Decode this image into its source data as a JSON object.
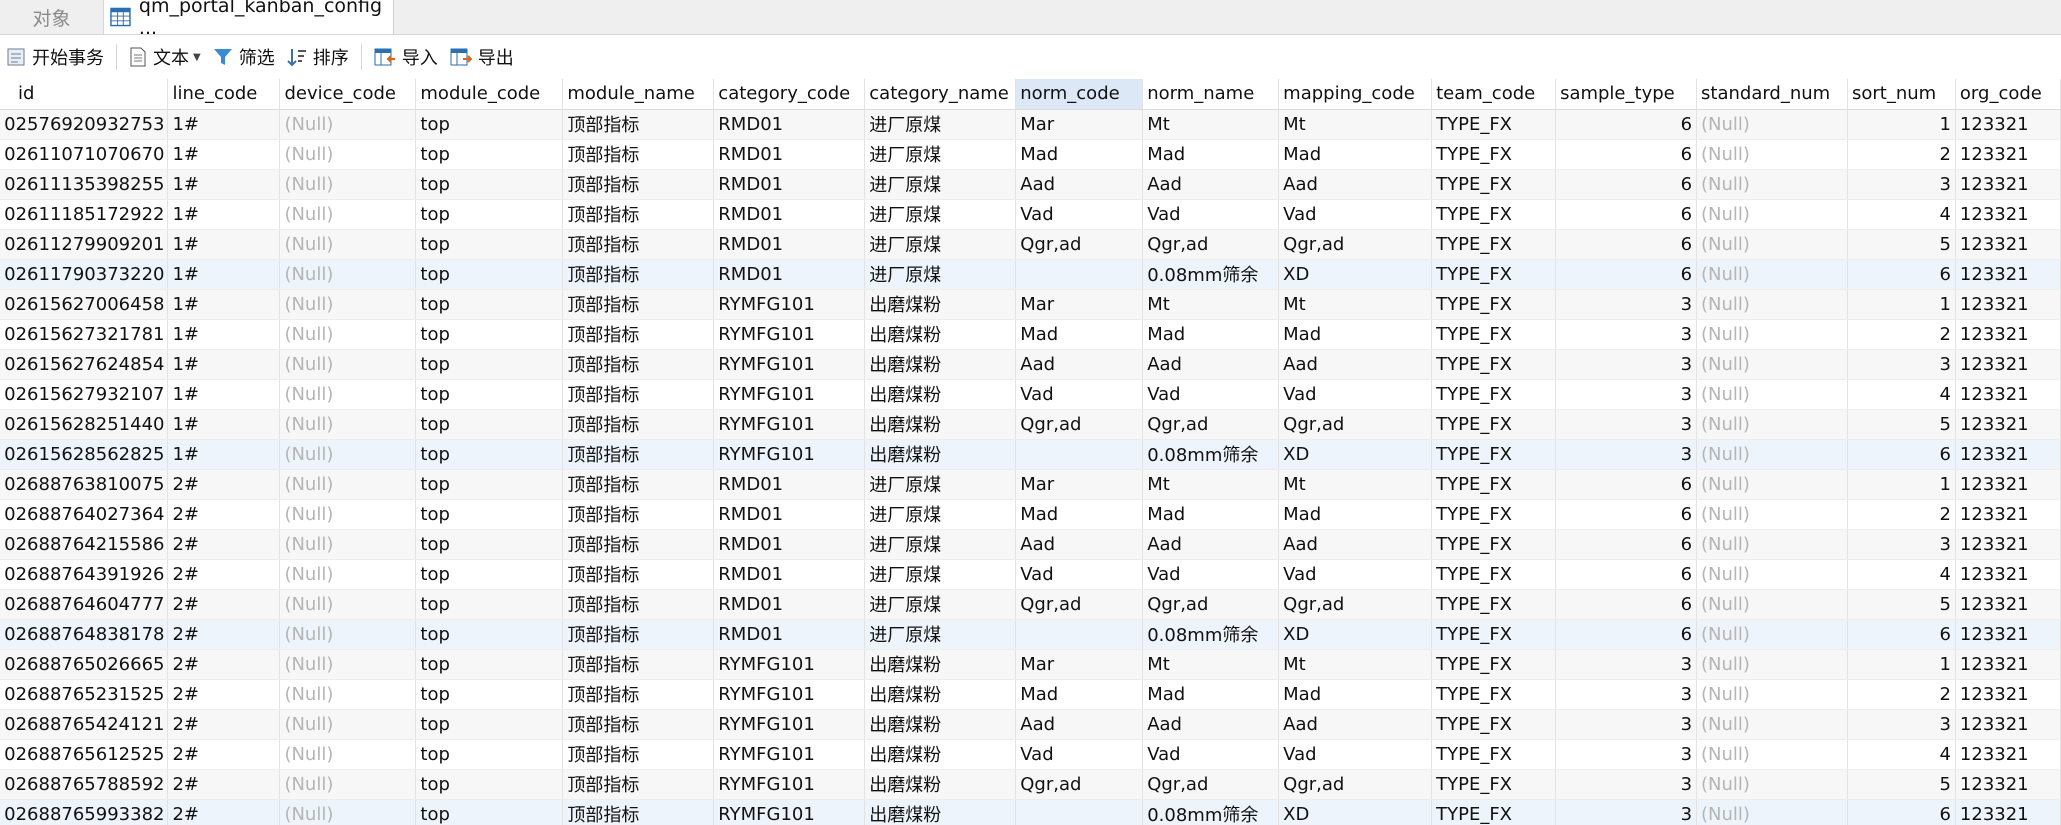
{
  "tabs": {
    "objects_label": "对象",
    "table_tab_label": "qm_portal_kanban_config ..."
  },
  "toolbar": {
    "begin_txn": "开始事务",
    "text": "文本",
    "filter": "筛选",
    "sort": "排序",
    "import": "导入",
    "export": "导出"
  },
  "colors": {
    "selected_header": "#dde8f6",
    "null_text": "#b5b5b5",
    "current_row": "#eef4fb"
  },
  "table": {
    "columns": [
      "id",
      "line_code",
      "device_code",
      "module_code",
      "module_name",
      "category_code",
      "category_name",
      "norm_code",
      "norm_name",
      "mapping_code",
      "team_code",
      "sample_type",
      "standard_num",
      "sort_num",
      "org_code"
    ],
    "selected_column": "norm_code",
    "rows": [
      [
        "02576920932753",
        "1#",
        "(Null)",
        "top",
        "顶部指标",
        "RMD01",
        "进厂原煤",
        "Mar",
        "Mt",
        "Mt",
        "TYPE_FX",
        "6",
        "(Null)",
        "1",
        "123321"
      ],
      [
        "02611071070670",
        "1#",
        "(Null)",
        "top",
        "顶部指标",
        "RMD01",
        "进厂原煤",
        "Mad",
        "Mad",
        "Mad",
        "TYPE_FX",
        "6",
        "(Null)",
        "2",
        "123321"
      ],
      [
        "02611135398255",
        "1#",
        "(Null)",
        "top",
        "顶部指标",
        "RMD01",
        "进厂原煤",
        "Aad",
        "Aad",
        "Aad",
        "TYPE_FX",
        "6",
        "(Null)",
        "3",
        "123321"
      ],
      [
        "02611185172922",
        "1#",
        "(Null)",
        "top",
        "顶部指标",
        "RMD01",
        "进厂原煤",
        "Vad",
        "Vad",
        "Vad",
        "TYPE_FX",
        "6",
        "(Null)",
        "4",
        "123321"
      ],
      [
        "02611279909201",
        "1#",
        "(Null)",
        "top",
        "顶部指标",
        "RMD01",
        "进厂原煤",
        "Qgr,ad",
        "Qgr,ad",
        "Qgr,ad",
        "TYPE_FX",
        "6",
        "(Null)",
        "5",
        "123321"
      ],
      [
        "02611790373220",
        "1#",
        "(Null)",
        "top",
        "顶部指标",
        "RMD01",
        "进厂原煤",
        "",
        "0.08mm筛余",
        "XD",
        "TYPE_FX",
        "6",
        "(Null)",
        "6",
        "123321"
      ],
      [
        "02615627006458",
        "1#",
        "(Null)",
        "top",
        "顶部指标",
        "RYMFG101",
        "出磨煤粉",
        "Mar",
        "Mt",
        "Mt",
        "TYPE_FX",
        "3",
        "(Null)",
        "1",
        "123321"
      ],
      [
        "02615627321781",
        "1#",
        "(Null)",
        "top",
        "顶部指标",
        "RYMFG101",
        "出磨煤粉",
        "Mad",
        "Mad",
        "Mad",
        "TYPE_FX",
        "3",
        "(Null)",
        "2",
        "123321"
      ],
      [
        "02615627624854",
        "1#",
        "(Null)",
        "top",
        "顶部指标",
        "RYMFG101",
        "出磨煤粉",
        "Aad",
        "Aad",
        "Aad",
        "TYPE_FX",
        "3",
        "(Null)",
        "3",
        "123321"
      ],
      [
        "02615627932107",
        "1#",
        "(Null)",
        "top",
        "顶部指标",
        "RYMFG101",
        "出磨煤粉",
        "Vad",
        "Vad",
        "Vad",
        "TYPE_FX",
        "3",
        "(Null)",
        "4",
        "123321"
      ],
      [
        "02615628251440",
        "1#",
        "(Null)",
        "top",
        "顶部指标",
        "RYMFG101",
        "出磨煤粉",
        "Qgr,ad",
        "Qgr,ad",
        "Qgr,ad",
        "TYPE_FX",
        "3",
        "(Null)",
        "5",
        "123321"
      ],
      [
        "02615628562825",
        "1#",
        "(Null)",
        "top",
        "顶部指标",
        "RYMFG101",
        "出磨煤粉",
        "",
        "0.08mm筛余",
        "XD",
        "TYPE_FX",
        "3",
        "(Null)",
        "6",
        "123321"
      ],
      [
        "02688763810075",
        "2#",
        "(Null)",
        "top",
        "顶部指标",
        "RMD01",
        "进厂原煤",
        "Mar",
        "Mt",
        "Mt",
        "TYPE_FX",
        "6",
        "(Null)",
        "1",
        "123321"
      ],
      [
        "02688764027364",
        "2#",
        "(Null)",
        "top",
        "顶部指标",
        "RMD01",
        "进厂原煤",
        "Mad",
        "Mad",
        "Mad",
        "TYPE_FX",
        "6",
        "(Null)",
        "2",
        "123321"
      ],
      [
        "02688764215586",
        "2#",
        "(Null)",
        "top",
        "顶部指标",
        "RMD01",
        "进厂原煤",
        "Aad",
        "Aad",
        "Aad",
        "TYPE_FX",
        "6",
        "(Null)",
        "3",
        "123321"
      ],
      [
        "02688764391926",
        "2#",
        "(Null)",
        "top",
        "顶部指标",
        "RMD01",
        "进厂原煤",
        "Vad",
        "Vad",
        "Vad",
        "TYPE_FX",
        "6",
        "(Null)",
        "4",
        "123321"
      ],
      [
        "02688764604777",
        "2#",
        "(Null)",
        "top",
        "顶部指标",
        "RMD01",
        "进厂原煤",
        "Qgr,ad",
        "Qgr,ad",
        "Qgr,ad",
        "TYPE_FX",
        "6",
        "(Null)",
        "5",
        "123321"
      ],
      [
        "02688764838178",
        "2#",
        "(Null)",
        "top",
        "顶部指标",
        "RMD01",
        "进厂原煤",
        "",
        "0.08mm筛余",
        "XD",
        "TYPE_FX",
        "6",
        "(Null)",
        "6",
        "123321"
      ],
      [
        "02688765026665",
        "2#",
        "(Null)",
        "top",
        "顶部指标",
        "RYMFG101",
        "出磨煤粉",
        "Mar",
        "Mt",
        "Mt",
        "TYPE_FX",
        "3",
        "(Null)",
        "1",
        "123321"
      ],
      [
        "02688765231525",
        "2#",
        "(Null)",
        "top",
        "顶部指标",
        "RYMFG101",
        "出磨煤粉",
        "Mad",
        "Mad",
        "Mad",
        "TYPE_FX",
        "3",
        "(Null)",
        "2",
        "123321"
      ],
      [
        "02688765424121",
        "2#",
        "(Null)",
        "top",
        "顶部指标",
        "RYMFG101",
        "出磨煤粉",
        "Aad",
        "Aad",
        "Aad",
        "TYPE_FX",
        "3",
        "(Null)",
        "3",
        "123321"
      ],
      [
        "02688765612525",
        "2#",
        "(Null)",
        "top",
        "顶部指标",
        "RYMFG101",
        "出磨煤粉",
        "Vad",
        "Vad",
        "Vad",
        "TYPE_FX",
        "3",
        "(Null)",
        "4",
        "123321"
      ],
      [
        "02688765788592",
        "2#",
        "(Null)",
        "top",
        "顶部指标",
        "RYMFG101",
        "出磨煤粉",
        "Qgr,ad",
        "Qgr,ad",
        "Qgr,ad",
        "TYPE_FX",
        "3",
        "(Null)",
        "5",
        "123321"
      ],
      [
        "02688765993382",
        "2#",
        "(Null)",
        "top",
        "顶部指标",
        "RYMFG101",
        "出磨煤粉",
        "",
        "0.08mm筛余",
        "XD",
        "TYPE_FX",
        "3",
        "(Null)",
        "6",
        "123321"
      ]
    ]
  }
}
